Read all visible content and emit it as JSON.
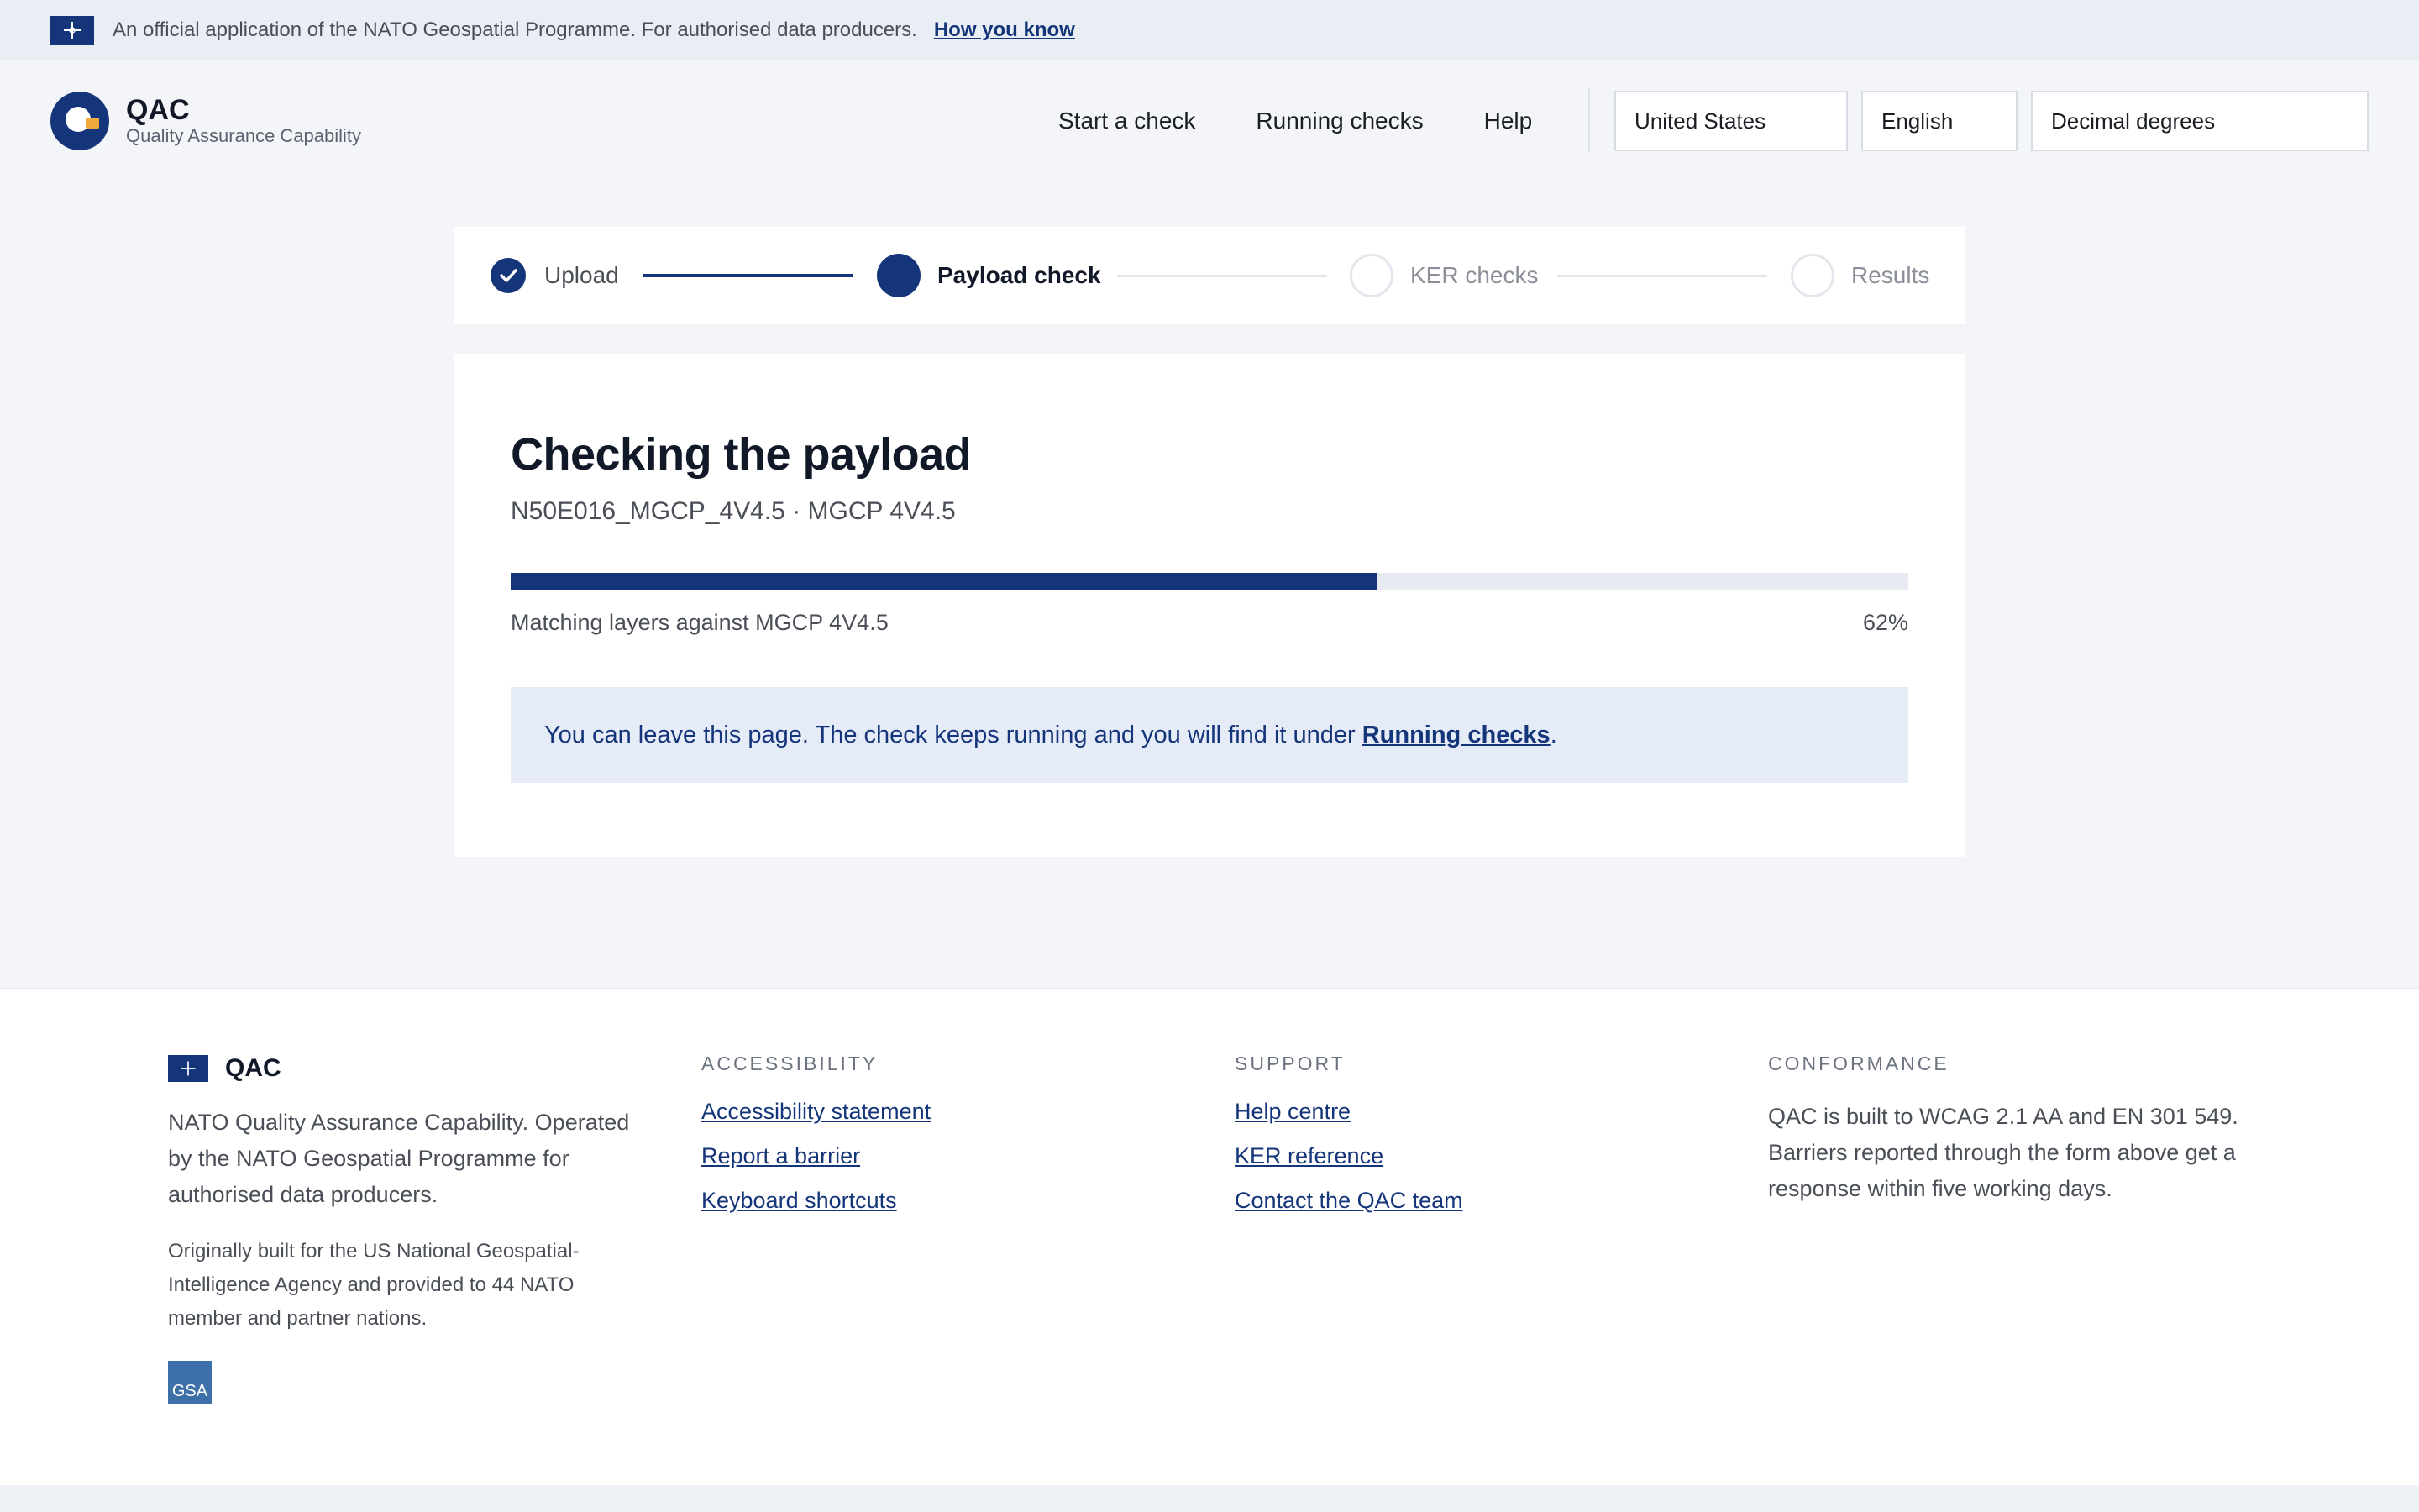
{
  "banner": {
    "text": "An official application of the NATO Geospatial Programme. For authorised data producers.",
    "link": "How you know"
  },
  "header": {
    "title": "QAC",
    "subtitle": "Quality Assurance Capability",
    "nav": [
      "Start a check",
      "Running checks",
      "Help"
    ],
    "country": "United States",
    "language": "English",
    "coordinates": "Decimal degrees"
  },
  "stepper": {
    "steps": [
      {
        "label": "Upload",
        "state": "complete"
      },
      {
        "label": "Payload check",
        "state": "current"
      },
      {
        "label": "KER checks",
        "state": "upcoming"
      },
      {
        "label": "Results",
        "state": "upcoming"
      }
    ]
  },
  "main": {
    "title": "Checking the payload",
    "subtitle": "N50E016_MGCP_4V4.5 · MGCP 4V4.5",
    "progress_value": 0.62,
    "progress_label": "Matching layers against MGCP 4V4.5",
    "progress_percent": "62%",
    "notice_text": "You can leave this page. The check keeps running and you will find it under",
    "notice_link": "Running checks",
    "notice_end": "."
  },
  "footer": {
    "brand": "QAC",
    "description": "NATO Quality Assurance Capability. Operated by the NATO Geospatial Programme for authorised data producers.",
    "origin": "Originally built for the US National Geospatial-Intelligence Agency and provided to 44 NATO member and partner nations.",
    "gsa_badge": "GSA",
    "accessibility": {
      "heading": "ACCESSIBILITY",
      "links": [
        "Accessibility statement",
        "Report a barrier",
        "Keyboard shortcuts"
      ]
    },
    "support": {
      "heading": "SUPPORT",
      "links": [
        "Help centre",
        "KER reference",
        "Contact the QAC team"
      ]
    },
    "conformance": {
      "heading": "CONFORMANCE",
      "text": "QAC is built to WCAG 2.1 AA and EN 301 549. Barriers reported through the form above get a response within five working days."
    }
  },
  "colors": {
    "brand": "#14357a",
    "accent": "#f2a93b",
    "notice_bg": "#e6ecf7"
  },
  "icons": {
    "flag": "nato-flag-icon",
    "logo": "qac-duck-logo",
    "check": "checkmark-icon"
  }
}
